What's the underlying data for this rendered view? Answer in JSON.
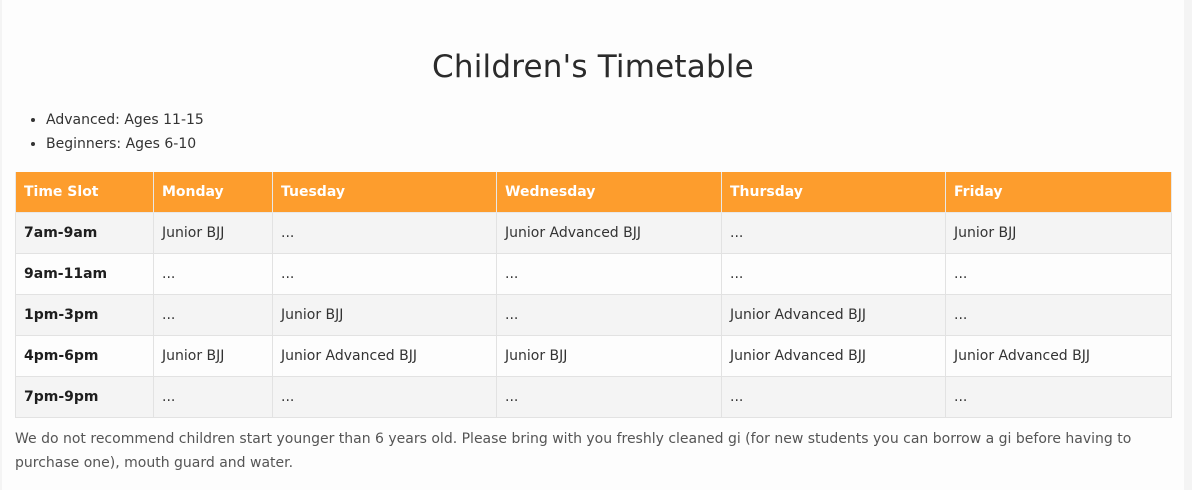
{
  "title": "Children's Timetable",
  "levels": [
    "Advanced: Ages 11-15",
    "Beginners: Ages 6-10"
  ],
  "timetable": {
    "headers": [
      "Time Slot",
      "Monday",
      "Tuesday",
      "Wednesday",
      "Thursday",
      "Friday"
    ],
    "rows": [
      [
        "7am-9am",
        "Junior BJJ",
        "...",
        "Junior Advanced BJJ",
        "...",
        "Junior BJJ"
      ],
      [
        "9am-11am",
        "...",
        "...",
        "...",
        "...",
        "..."
      ],
      [
        "1pm-3pm",
        "...",
        "Junior BJJ",
        "...",
        "Junior Advanced BJJ",
        "..."
      ],
      [
        "4pm-6pm",
        "Junior BJJ",
        "Junior Advanced BJJ",
        "Junior BJJ",
        "Junior Advanced BJJ",
        "Junior Advanced BJJ"
      ],
      [
        "7pm-9pm",
        "...",
        "...",
        "...",
        "...",
        "..."
      ]
    ]
  },
  "note": "We do not recommend children start younger than 6 years old. Please bring with you freshly cleaned gi (for new students you can borrow a gi before having to purchase one), mouth guard and water.",
  "colors": {
    "header_bg": "#fd9d2d",
    "header_text": "#ffffff",
    "row_alt_bg": "#f4f4f4"
  }
}
